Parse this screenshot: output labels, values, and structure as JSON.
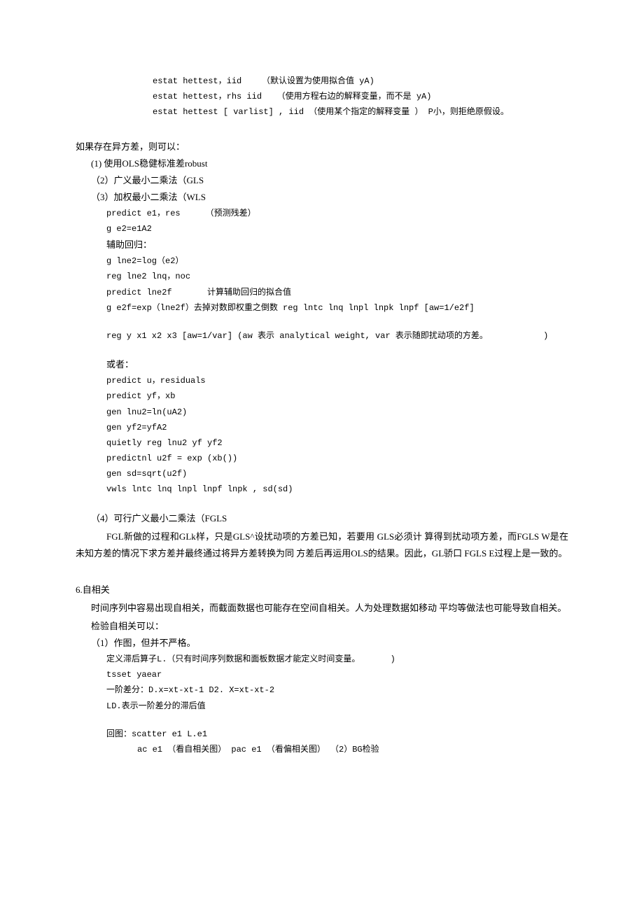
{
  "block1": {
    "l1": "estat hettest，iid    （默认设置为使用拟合值 yA)",
    "l2": "estat hettest，rhs iid   （使用方程右边的解释变量，而不是 yA)",
    "l3": "estat hettest [ varlist] , iid （使用某个指定的解释变量 ） P小，则拒绝原假设。"
  },
  "sec1": {
    "heading": "如果存在异方差，则可以：",
    "i1": "(1) 使用OLS稳健标准差robust",
    "i2": "（2）广义最小二乘法（GLS",
    "i3": "（3）加权最小二乘法（WLS",
    "code1": "predict e1，res     （预测残差）",
    "code2": "g e2=e1A2",
    "code3": "辅助回归：",
    "code4": "g lne2=log（e2）",
    "code5": "reg lne2 lnq，noc",
    "code6": "predict lne2f       计算辅助回归的拟合值",
    "code7": "g e2f=exp（lne2f）去掉对数即权重之倒数 reg lntc lnq lnpl lnpk lnpf [aw=1/e2f]",
    "code8": "reg y x1 x2 x3 [aw=1/var] (aw 表示 analytical weight, var 表示随即扰动项的方差。           )",
    "or": "或者：",
    "alt1": "predict u，residuals",
    "alt2": "predict yf，xb",
    "alt3": "gen lnu2=ln(uA2)",
    "alt4": "gen yf2=yfA2",
    "alt5": "quietly reg lnu2 yf yf2",
    "alt6": "predictnl u2f = exp (xb())",
    "alt7": "gen sd=sqrt(u2f)",
    "alt8": "vwls lntc lnq lnpl lnpf lnpk , sd(sd)",
    "i4": "（4）可行广义最小二乘法（FGLS",
    "p1": "FGL新做的过程和GLk样，只是GLS^设扰动项的方差已知，若要用 GLS必须计 算得到扰动项方差，而FGLS W是在未知方差的情况下求方差并最终通过将异方差转换为同 方差后再运用OLS的结果。因此，GL骄口 FGLS E过程上是一致的。"
  },
  "sec2": {
    "heading": "6.自相关",
    "p1": "时间序列中容易出现自相关，而截面数据也可能存在空间自相关。人为处理数据如移动 平均等做法也可能导致自相关。",
    "p2": "检验自相关可以：",
    "i1": "（1）作图，但并不严格。",
    "c1": "定义滞后算子L.（只有时间序列数据和面板数据才能定义时间变量。      )",
    "c2": "tsset yaear",
    "c3": "一阶差分：D.x=xt-xt-1 D2. X=xt-xt-2",
    "c4": "LD.表示一阶差分的滞后值",
    "c5": "回图：scatter e1 L.e1",
    "c6": "ac e1 （看自相关图） pac e1 （看偏相关图） （2）BG检验"
  }
}
